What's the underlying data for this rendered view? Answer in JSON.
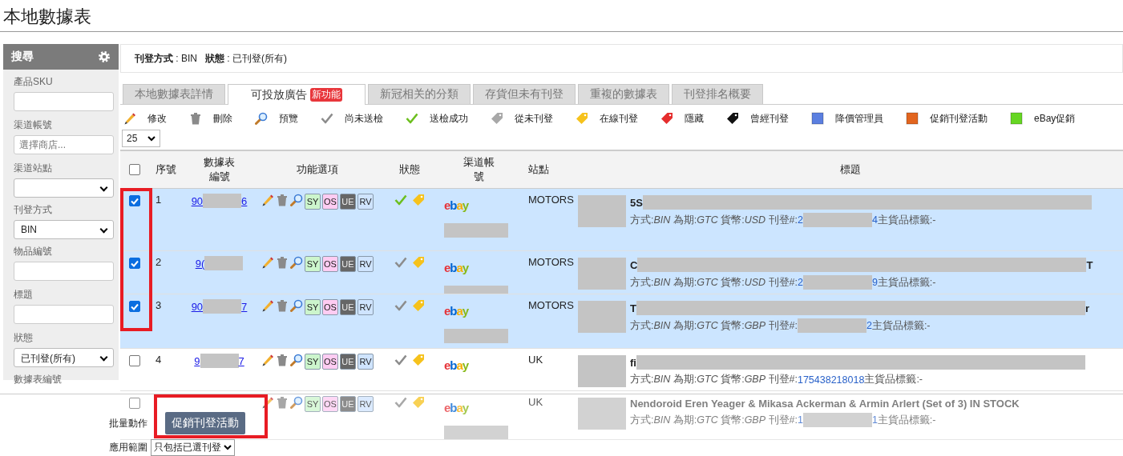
{
  "page_title": "本地數據表",
  "sidebar": {
    "title": "搜尋",
    "fields": [
      {
        "label": "產品SKU",
        "kind": "text"
      },
      {
        "label": "渠道帳號",
        "kind": "text",
        "placeholder": "選擇商店..."
      },
      {
        "label": "渠道站點",
        "kind": "select"
      },
      {
        "label": "刊登方式",
        "kind": "select",
        "value": "BIN"
      },
      {
        "label": "物品編號",
        "kind": "text"
      },
      {
        "label": "標題",
        "kind": "text"
      },
      {
        "label": "狀態",
        "kind": "select",
        "value": "已刊登(所有)"
      },
      {
        "label": "數據表編號",
        "kind": "label"
      }
    ]
  },
  "filter_summary": [
    {
      "label": "刊登方式",
      "value": " : BIN"
    },
    {
      "label": "狀態",
      "value": " : 已刊登(所有)"
    }
  ],
  "tabs": [
    {
      "label": "本地數據表詳情",
      "selected": false
    },
    {
      "label": "可投放廣告",
      "badge": "新功能",
      "selected": true
    },
    {
      "label": "新冠相关的分類",
      "selected": false
    },
    {
      "label": "存貨但未有刊登",
      "selected": false
    },
    {
      "label": "重複的數據表",
      "selected": false
    },
    {
      "label": "刊登排名概要",
      "selected": false
    }
  ],
  "legend": [
    {
      "kind": "pencil",
      "label": "修改"
    },
    {
      "kind": "trash",
      "label": "刪除"
    },
    {
      "kind": "magnifier",
      "label": "預覽"
    },
    {
      "kind": "check",
      "color": "#8c8c8c",
      "label": "尚未送檢"
    },
    {
      "kind": "check",
      "color": "#6cbf1e",
      "label": "送檢成功"
    },
    {
      "kind": "tag",
      "color": "#a8a8a8",
      "label": "從未刊登"
    },
    {
      "kind": "tag",
      "color": "#f6c21c",
      "label": "在線刊登"
    },
    {
      "kind": "tag",
      "color": "#e52d2d",
      "label": "隱藏"
    },
    {
      "kind": "tag",
      "color": "#111111",
      "label": "曾經刊登"
    },
    {
      "kind": "square",
      "color": "#5b7fe0",
      "label": "降價管理員"
    },
    {
      "kind": "square",
      "color": "#e2651f",
      "label": "促銷刊登活動"
    },
    {
      "kind": "square",
      "color": "#66d623",
      "label": "eBay促銷"
    }
  ],
  "page_size": "25",
  "table": {
    "select_all_checked": false,
    "columns": [
      "序號",
      "數據表編號",
      "功能選項",
      "狀態",
      "渠道帳號",
      "站點",
      "標題"
    ],
    "rows": [
      {
        "selected": true,
        "faded": false,
        "index": "1",
        "id_start": "90",
        "id_end": "6",
        "options": [
          "SY",
          "OS",
          "UE",
          "RV"
        ],
        "inspected": true,
        "online": true,
        "channel_logo": "ebay",
        "site": "MOTORS",
        "title_start": "5S",
        "title_end": "",
        "info": "方式:*BIN* 為期:*GTC* 貨幣:*USD* 刊登#:",
        "listing_start": "2",
        "listing_end": "4",
        "info_end": " 主貨品標籤:-"
      },
      {
        "selected": true,
        "faded": false,
        "index": "2",
        "id_start": "9(",
        "id_end": "",
        "options": [
          "SY",
          "OS",
          "UE",
          "RV"
        ],
        "inspected": false,
        "online": true,
        "channel_logo": "ebay",
        "site": "MOTORS",
        "title_start": "C",
        "title_end": "T",
        "info": "方式:*BIN* 為期:*GTC* 貨幣:*USD* 刊登#:",
        "listing_start": "2",
        "listing_end": "9",
        "info_end": " 主貨品標籤:-"
      },
      {
        "selected": true,
        "faded": false,
        "index": "3",
        "id_start": "90",
        "id_end": "7",
        "options": [
          "SY",
          "OS",
          "UE",
          "RV"
        ],
        "inspected": false,
        "online": true,
        "channel_logo": "ebay",
        "site": "MOTORS",
        "title_start": "T",
        "title_end": "r",
        "info": "方式:*BIN* 為期:*GTC* 貨幣:*GBP* 刊登#:",
        "listing_start": "",
        "listing_end": "2",
        "info_end": " 主貨品標籤:-"
      },
      {
        "selected": false,
        "faded": false,
        "index": "4",
        "id_start": "9",
        "id_end": "7",
        "options": [
          "SY",
          "OS",
          "UE",
          "RV"
        ],
        "inspected": false,
        "online": true,
        "channel_logo": "ebay",
        "site": "UK",
        "title_start": "fi",
        "title_end": "",
        "info": "方式:*BIN* 為期:*GTC* 貨幣:*GBP* 刊登#:",
        "listing_start": "175438218018",
        "listing_end": "",
        "info_end": " 主貨品標籤:-"
      },
      {
        "selected": false,
        "faded": true,
        "id_start": "",
        "id_end": "",
        "options": [
          "SY",
          "OS",
          "UE",
          "RV"
        ],
        "inspected": false,
        "online": true,
        "channel_logo": "ebay",
        "site": "UK",
        "title_start": "Nendoroid Eren Yeager & Mikasa Ackerman & Armin Arlert (Set of 3) IN STOCK",
        "title_end": "",
        "info": "方式:*BIN* 為期:*GTC* 貨幣:*GBP* 刊登#:",
        "listing_start": "1",
        "listing_end": "1",
        "info_end": " 主貨品標籤:-"
      }
    ]
  },
  "bulk": {
    "action_label": "批量動作",
    "action_button": "促銷刊登活動",
    "scope_label": "應用範圍",
    "scope_value": "只包括已選刊登"
  }
}
